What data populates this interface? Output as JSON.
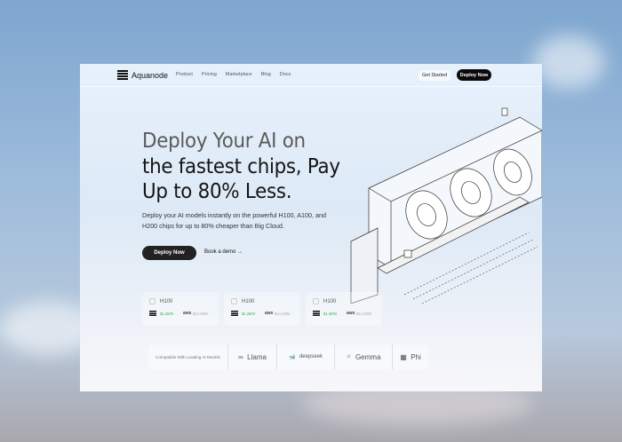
{
  "brand": {
    "name": "Aquanode"
  },
  "nav": {
    "links": [
      "Product",
      "Pricing",
      "Marketplace",
      "Blog",
      "Docs"
    ],
    "get_started": "Get Started",
    "deploy_now": "Deploy Now"
  },
  "hero": {
    "title_line1": "Deploy Your AI on",
    "title_line2": "the fastest chips, Pay",
    "title_line3": "Up to 80% Less.",
    "subtitle": "Deploy your AI models instantly on the powerful H100, A100, and H200 chips for up to 80% cheaper than Big Cloud.",
    "cta": "Deploy Now",
    "demo": "Book a demo",
    "demo_arrow": "→"
  },
  "pricing_cards": [
    {
      "chip": "H100",
      "aquanode_price": "$1.28/hr",
      "aws_label": "aws",
      "aws_price": "$14.29/hr"
    },
    {
      "chip": "H100",
      "aquanode_price": "$1.28/hr",
      "aws_label": "aws",
      "aws_price": "$14.29/hr"
    },
    {
      "chip": "H100",
      "aquanode_price": "$1.28/hr",
      "aws_label": "aws",
      "aws_price": "$14.29/hr"
    }
  ],
  "compat": {
    "label": "Compatible With Leading AI Models",
    "models": [
      {
        "icon": "∞",
        "name": "Llama"
      },
      {
        "icon": "🐋",
        "name": "deepseek"
      },
      {
        "icon": "✳",
        "name": "Gemma"
      },
      {
        "icon": "▦",
        "name": "Phi"
      }
    ]
  }
}
